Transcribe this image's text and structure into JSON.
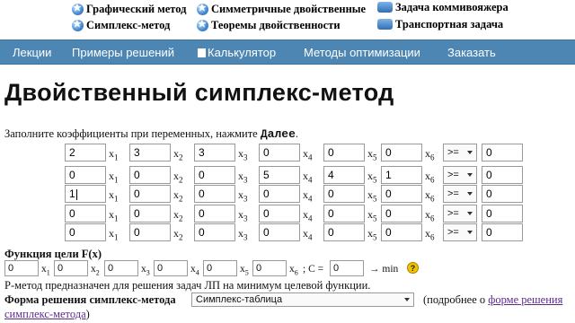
{
  "top_links": [
    {
      "label": "Графический метод",
      "icon": "globe-icon"
    },
    {
      "label": "Симметричные двойственные",
      "icon": "globe-icon"
    },
    {
      "label": "Задача коммивояжера",
      "icon": "car-icon"
    },
    {
      "label": "Симплекс-метод",
      "icon": "globe-icon"
    },
    {
      "label": "Теоремы двойственности",
      "icon": "globe-icon"
    },
    {
      "label": "Транспортная задача",
      "icon": "car-icon"
    }
  ],
  "nav": [
    "Лекции",
    "Примеры решений",
    "Калькулятор",
    "Методы оптимизации",
    "Заказать"
  ],
  "title": "Двойственный симплекс-метод",
  "instruction": {
    "text": "Заполните коэффициенты при переменных, нажмите ",
    "button_word": "Далее",
    "end": "."
  },
  "var_prefix": "x",
  "var_subs": [
    "1",
    "2",
    "3",
    "4",
    "5",
    "6"
  ],
  "matrix": [
    {
      "coefs": [
        "2",
        "3",
        "3",
        "0",
        "0",
        "0"
      ],
      "sign": ">=",
      "rhs": "0"
    },
    {
      "coefs": [
        "0",
        "0",
        "0",
        "5",
        "4",
        "1"
      ],
      "sign": ">=",
      "rhs": "0"
    },
    {
      "coefs": [
        "1",
        "0",
        "0",
        "0",
        "0",
        "0"
      ],
      "sign": ">=",
      "rhs": "0"
    },
    {
      "coefs": [
        "0",
        "0",
        "0",
        "0",
        "0",
        "0"
      ],
      "sign": ">=",
      "rhs": "0"
    },
    {
      "coefs": [
        "0",
        "0",
        "0",
        "0",
        "0",
        "0"
      ],
      "sign": ">=",
      "rhs": "0"
    }
  ],
  "objective": {
    "label": "Функция цели F(x)",
    "coefs": [
      "0",
      "0",
      "0",
      "0",
      "0",
      "0"
    ],
    "c_label": "; C =",
    "c_value": "0",
    "goal": "→ min",
    "help": "?"
  },
  "description": "P-метод предназначен для решения задач ЛП на минимум целевой функции.",
  "form": {
    "label": "Форма решения симплекс-метода",
    "selected": "Симплекс-таблица",
    "note_prefix": "(подробнее о ",
    "link_part1": "форме решения",
    "link_part2": "симплекс-метода",
    "note_suffix": ")"
  }
}
